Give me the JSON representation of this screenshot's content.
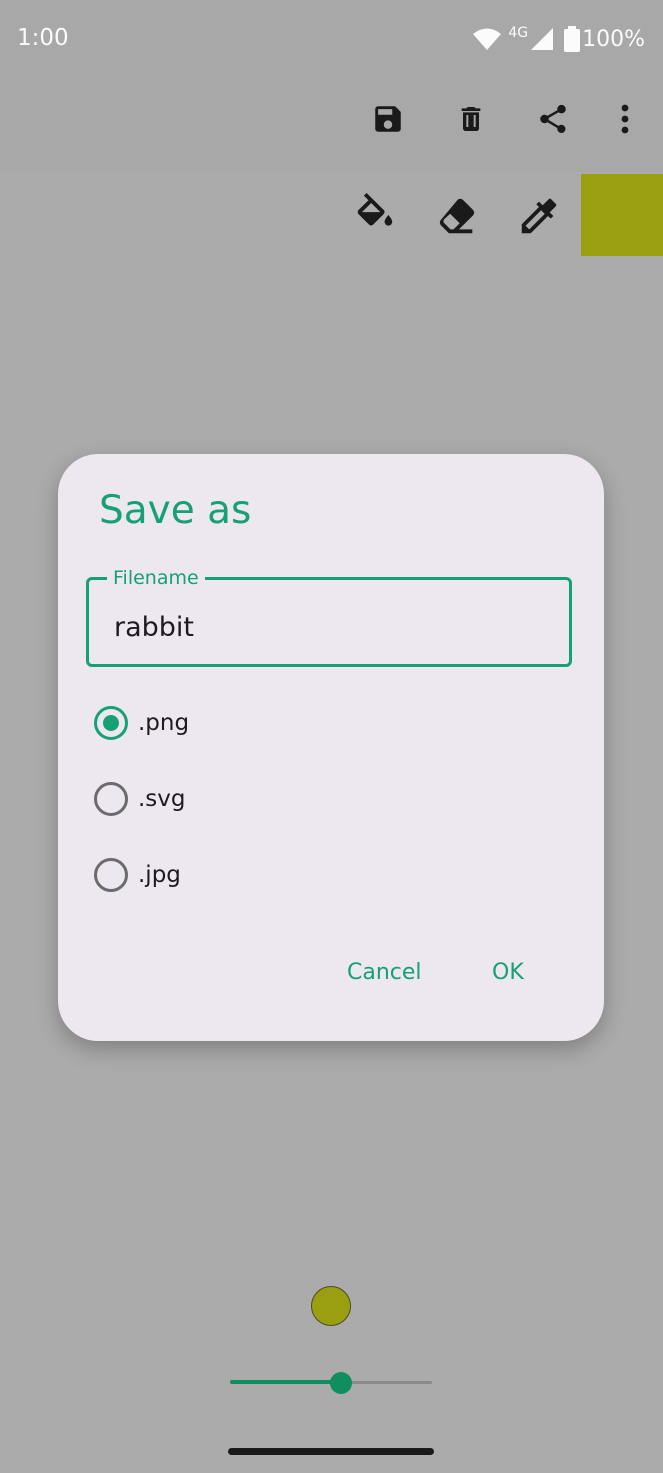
{
  "status_bar": {
    "time": "1:00",
    "network": "4G",
    "battery": "100%"
  },
  "toolbar": {
    "icons": [
      "save-icon",
      "delete-icon",
      "share-icon",
      "more-vert-icon"
    ]
  },
  "tools": {
    "icons": [
      "fill-bucket-icon",
      "eraser-icon",
      "eyedropper-icon"
    ],
    "current_color": "#9a9f12"
  },
  "dialog": {
    "title": "Save as",
    "filename_label": "Filename",
    "filename_value": "rabbit",
    "formats": [
      ".png",
      ".svg",
      ".jpg"
    ],
    "selected_format": ".png",
    "cancel_label": "Cancel",
    "ok_label": "OK"
  },
  "brush": {
    "size_fraction": 0.55,
    "color": "#9a9f12"
  },
  "colors": {
    "accent": "#15a173"
  }
}
